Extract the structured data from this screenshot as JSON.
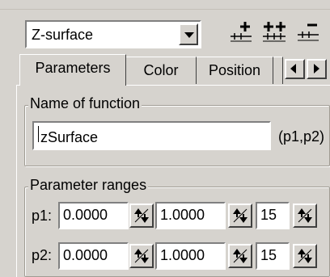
{
  "toolbar": {
    "function_combo": {
      "selected": "Z-surface"
    },
    "icons": [
      "add-function-icon",
      "add-multiple-functions-icon",
      "remove-function-icon"
    ]
  },
  "tabs": [
    {
      "label": "Parameters",
      "active": true
    },
    {
      "label": "Color",
      "active": false
    },
    {
      "label": "Position",
      "active": false
    }
  ],
  "name_group": {
    "legend": "Name of function",
    "value": "zSurface",
    "args": "(p1,p2)"
  },
  "ranges_group": {
    "legend": "Parameter ranges",
    "rows": [
      {
        "label": "p1:",
        "min": "0.0000",
        "max": "1.0000",
        "steps": "15"
      },
      {
        "label": "p2:",
        "min": "0.0000",
        "max": "1.0000",
        "steps": "15"
      }
    ]
  }
}
